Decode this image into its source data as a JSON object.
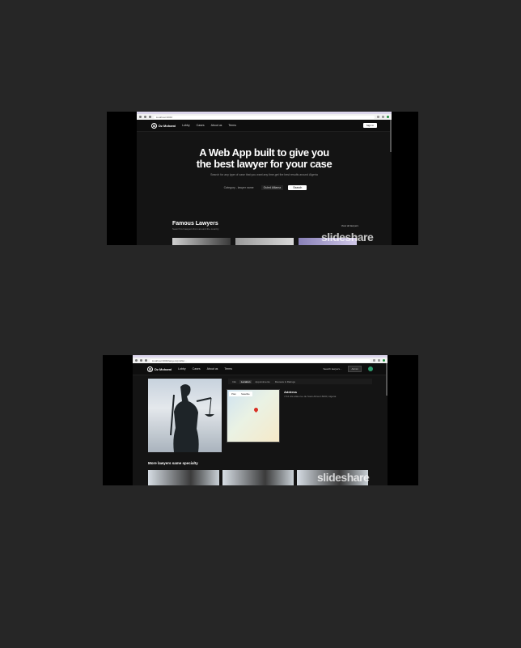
{
  "slide1": {
    "url": "localhost:3000/",
    "brand": "Dz Mohami",
    "nav": [
      "Lobby",
      "Cases",
      "About us",
      "Terms"
    ],
    "signin_label": "Sign in",
    "hero": {
      "title_line1": "A Web App built to give you",
      "title_line2": "the best lawyer for your case",
      "subtitle": "Search for any type of case that you want any time,get the best results around Algeria"
    },
    "search": {
      "category": "Category , lawyer name",
      "location": "Ouled Alliama",
      "button": "Search"
    },
    "famous": {
      "title": "Famous Lawyers",
      "subtitle": "Search for lawyers from around the country",
      "view_all": "View all lawyers"
    },
    "watermark": "slideshare"
  },
  "slide2": {
    "url": "localhost:3000/lawyers/profile/...",
    "brand": "Dz Mohami",
    "nav": [
      "Lobby",
      "Cases",
      "About us",
      "Terms"
    ],
    "search_label": "Search lawyers...",
    "action_label": "Admin",
    "tabs": [
      "Info",
      "Location",
      "Appointments",
      "Reviews & Ratings"
    ],
    "map_tabs": [
      "Plan",
      "Satellite"
    ],
    "address": {
      "title": "Address",
      "text": "n°12 cité alias rue de Souk Ahras 16000, Algeria"
    },
    "more_title": "More lawyers same specialty",
    "watermark": "slideshare"
  },
  "colors": {
    "page_bg": "#262626",
    "slide_bg": "#000000",
    "app_bg": "#141414",
    "accent_green": "#2e9a6e"
  }
}
